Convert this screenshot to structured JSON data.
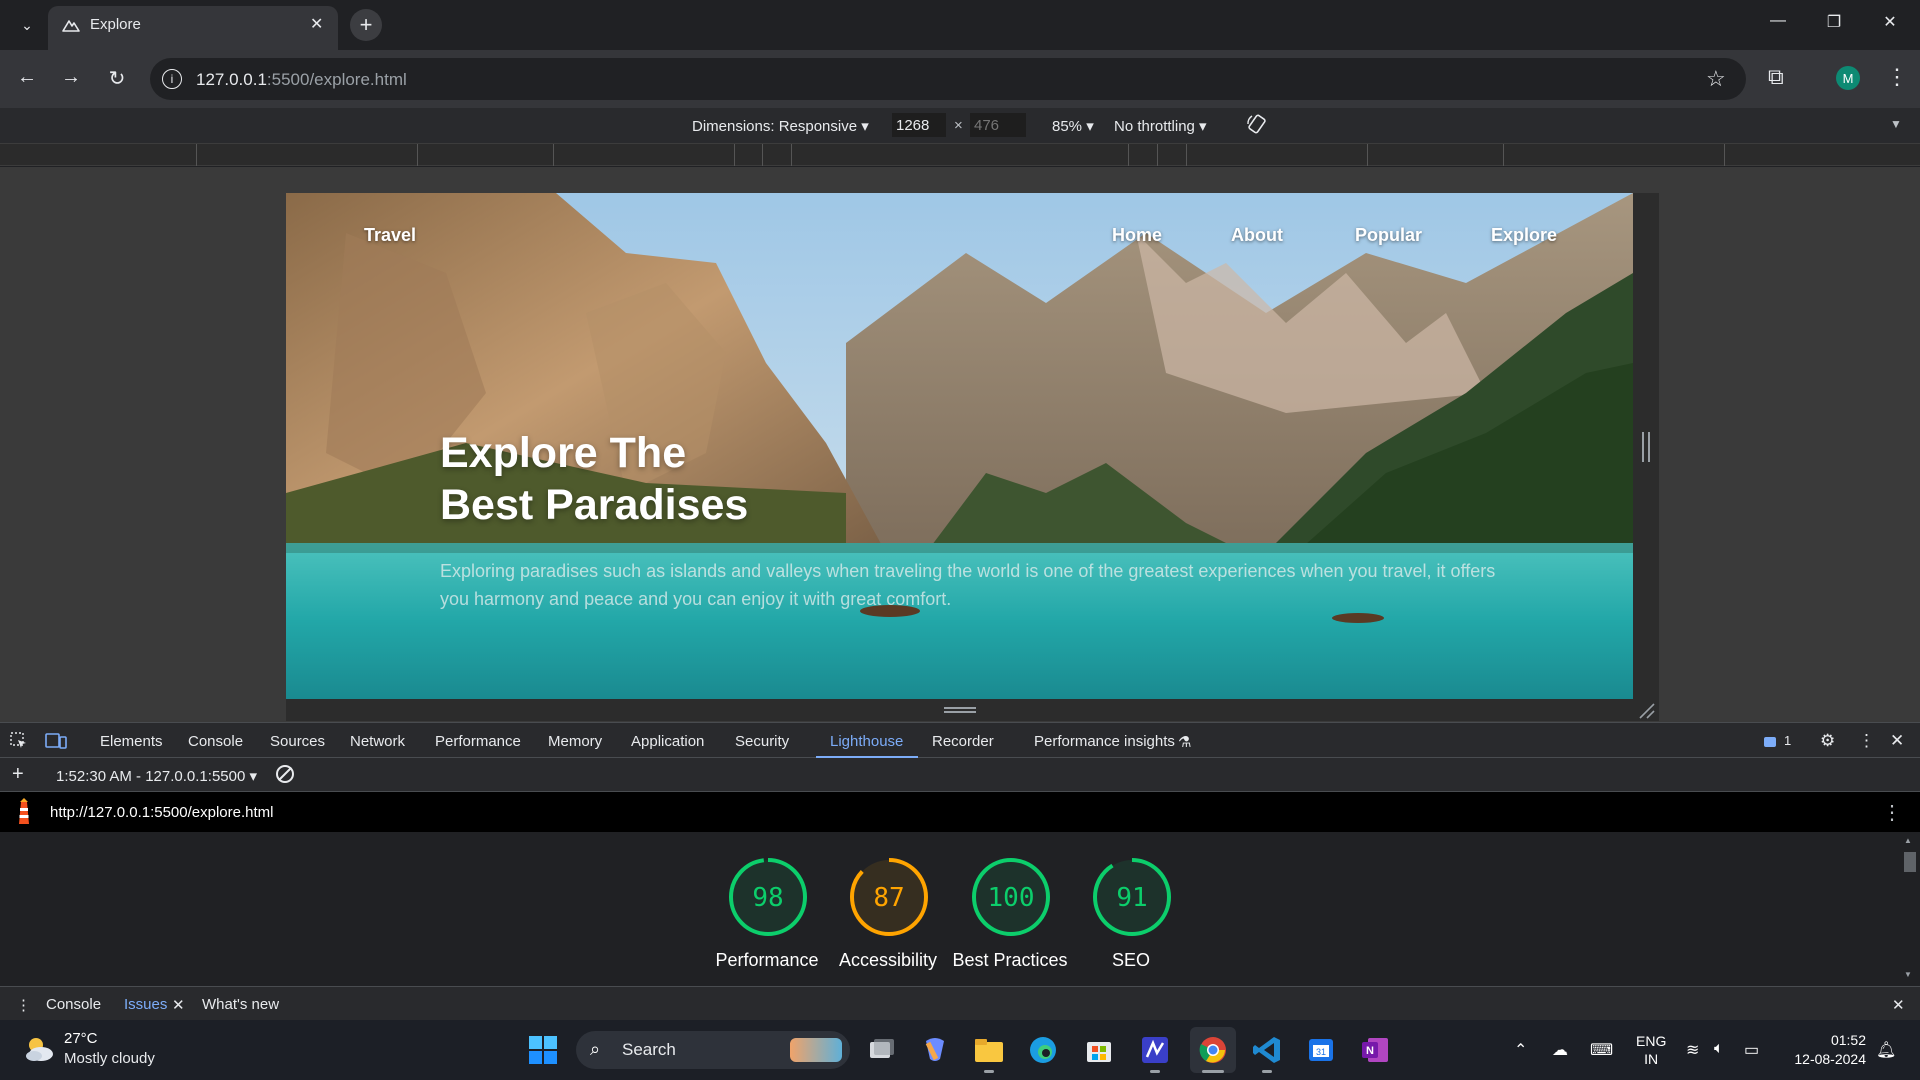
{
  "browser": {
    "tab_title": "Explore",
    "url_host": "127.0.0.1",
    "url_rest": ":5500/explore.html",
    "profile_initial": "M"
  },
  "device_toolbar": {
    "dimensions": "Dimensions: Responsive ▾",
    "width": "1268",
    "height_placeholder": "476",
    "times": "×",
    "zoom": "85% ▾",
    "throttling": "No throttling ▾"
  },
  "page": {
    "brand": "Travel",
    "nav": [
      "Home",
      "About",
      "Popular",
      "Explore"
    ],
    "title_line1": "Explore The",
    "title_line2": "Best Paradises",
    "description": "Exploring paradises such as islands and valleys when traveling the world is one of the greatest experiences when you travel, it offers you harmony and peace and you can enjoy it with great comfort."
  },
  "devtools": {
    "tabs": [
      "Elements",
      "Console",
      "Sources",
      "Network",
      "Performance",
      "Memory",
      "Application",
      "Security",
      "Lighthouse",
      "Recorder",
      "Performance insights"
    ],
    "issues_count": "1",
    "report_select": "1:52:30 AM - 127.0.0.1:5500 ▾",
    "report_url": "http://127.0.0.1:5500/explore.html",
    "drawer_tabs": [
      "Console",
      "Issues",
      "What's new"
    ]
  },
  "lighthouse": {
    "scores": [
      {
        "label": "Performance",
        "score": 98,
        "color": "#0cce6b"
      },
      {
        "label": "Accessibility",
        "score": 87,
        "color": "#ffa400"
      },
      {
        "label": "Best Practices",
        "score": 100,
        "color": "#0cce6b"
      },
      {
        "label": "SEO",
        "score": 91,
        "color": "#0cce6b"
      }
    ]
  },
  "taskbar": {
    "temperature": "27°C",
    "weather": "Mostly cloudy",
    "search": "Search",
    "lang_line1": "ENG",
    "lang_line2": "IN",
    "time": "01:52",
    "date": "12-08-2024",
    "apps": [
      "task-view",
      "copilot",
      "file-explorer",
      "edge",
      "microsoft-store",
      "app-purple",
      "chrome",
      "vscode",
      "calendar",
      "onenote"
    ]
  },
  "colors": {
    "lighthouse_accent": "#7cacf8",
    "good": "#0cce6b",
    "average": "#ffa400"
  }
}
